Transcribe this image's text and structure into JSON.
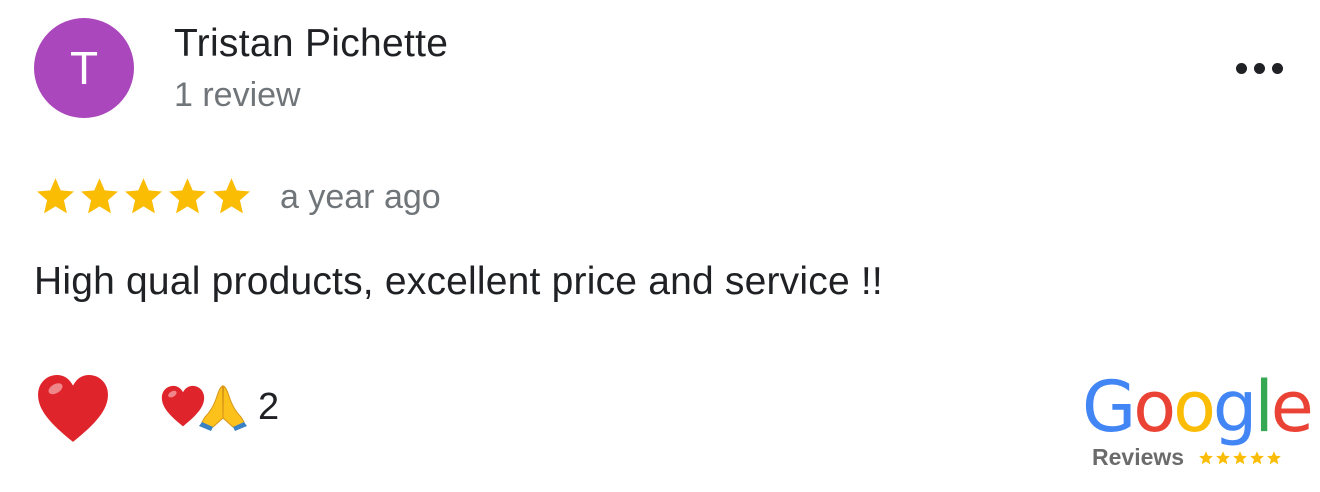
{
  "review": {
    "author": {
      "initial": "T",
      "name": "Tristan Pichette",
      "review_count": "1 review",
      "avatar_color": "#ab47bc"
    },
    "rating": 5,
    "time_ago": "a year ago",
    "text": "High qual products, excellent price and service !!",
    "reactions": {
      "icons": [
        "heart-icon",
        "folded-hands-icon"
      ],
      "count": "2"
    },
    "menu_icon": "more-horizontal-icon"
  },
  "badge": {
    "brand": "Google",
    "label": "Reviews",
    "stars": 5,
    "letter_colors": [
      "#4285F4",
      "#EA4335",
      "#FBBC05",
      "#4285F4",
      "#34A853",
      "#EA4335"
    ]
  },
  "colors": {
    "star": "#fbbc04",
    "heart": "#e0242b"
  }
}
